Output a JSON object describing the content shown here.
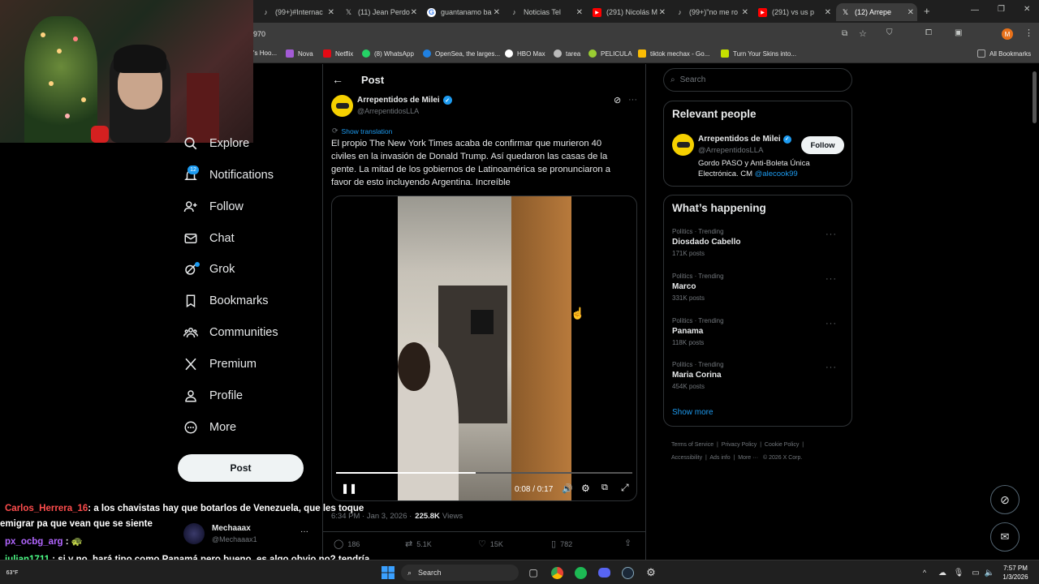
{
  "browser": {
    "tabs": [
      {
        "label": "(99+)#Internac",
        "icon": "tiktok-icon"
      },
      {
        "label": "(11) Jean Perdo",
        "icon": "x-icon"
      },
      {
        "label": "guantanamo ba",
        "icon": "google-icon"
      },
      {
        "label": "Noticias Tel",
        "icon": "tiktok-icon"
      },
      {
        "label": "(291) Nicolás M",
        "icon": "youtube-icon"
      },
      {
        "label": "(99+)\"no me ro",
        "icon": "tiktok-icon"
      },
      {
        "label": "(291) vs us p",
        "icon": "youtube-icon"
      },
      {
        "label": "(12) Arrepe",
        "icon": "x-icon"
      }
    ],
    "new_tab": "+",
    "address": "970",
    "bookmarks": [
      "'s Hoo...",
      "Nova",
      "Netflix",
      "(8) WhatsApp",
      "OpenSea, the larges...",
      "HBO Max",
      "tarea",
      "PELICULA",
      "tiktok mechax - Go...",
      "Turn Your Skins into..."
    ],
    "all_bookmarks": "All Bookmarks",
    "profile_letter": "M"
  },
  "sidebar": {
    "items": [
      {
        "label": "Explore",
        "icon": "search-icon"
      },
      {
        "label": "Notifications",
        "icon": "bell-icon",
        "badge": "12"
      },
      {
        "label": "Follow",
        "icon": "add-user-icon"
      },
      {
        "label": "Chat",
        "icon": "mail-icon"
      },
      {
        "label": "Grok",
        "icon": "grok-icon"
      },
      {
        "label": "Bookmarks",
        "icon": "bookmark-icon"
      },
      {
        "label": "Communities",
        "icon": "communities-icon"
      },
      {
        "label": "Premium",
        "icon": "x-logo-icon"
      },
      {
        "label": "Profile",
        "icon": "profile-icon"
      },
      {
        "label": "More",
        "icon": "more-icon"
      }
    ],
    "post_button": "Post",
    "account": {
      "name": "Mechaaax",
      "handle": "@Mechaaax1"
    }
  },
  "post": {
    "header": "Post",
    "author_name": "Arrepentidos de Milei",
    "author_handle": "@ArrepentidosLLA",
    "show_translation": "Show translation",
    "text": "El propio The New York Times acaba de confirmar que murieron 40 civiles en la invasión de Donald Trump. Así quedaron las casas de la gente. La mitad de los gobiernos de Latinoamérica se pronunciaron a favor de esto incluyendo Argentina. Increíble",
    "video": {
      "time": "0:08 / 0:17",
      "progress": 0.47
    },
    "meta_time": "6:34 PM · Jan 3, 2026 ·",
    "views_count": "225.8K",
    "views_label": "Views",
    "stats": {
      "replies": "186",
      "reposts": "5.1K",
      "likes": "15K",
      "bookmarks": "782"
    }
  },
  "right": {
    "search_placeholder": "Search",
    "relevant": {
      "title": "Relevant people",
      "name": "Arrepentidos de Milei",
      "handle": "@ArrepentidosLLA",
      "follow": "Follow",
      "bio": "Gordo PASO y Anti-Boleta Única Electrónica. CM",
      "bio_link": "@alecook99"
    },
    "happening": {
      "title": "What’s happening",
      "trends": [
        {
          "category": "Politics · Trending",
          "name": "Diosdado Cabello",
          "count": "171K posts"
        },
        {
          "category": "Politics · Trending",
          "name": "Marco",
          "count": "331K posts"
        },
        {
          "category": "Politics · Trending",
          "name": "Panama",
          "count": "118K posts"
        },
        {
          "category": "Politics · Trending",
          "name": "Maria Corina",
          "count": "454K posts"
        }
      ],
      "show_more": "Show more"
    },
    "footer": [
      "Terms of Service",
      "Privacy Policy",
      "Cookie Policy",
      "Accessibility",
      "Ads info",
      "More ···",
      "© 2026 X Corp."
    ]
  },
  "chat": [
    {
      "user": "Carlos_Herrera_16",
      "color": "#ff4d4d",
      "text": ": a los chavistas hay que botarlos de Venezuela, que les toque emigrar pa que vean que se siente"
    },
    {
      "user": "px_ocbg_arg",
      "color": "#b266ff",
      "text": ": 🐢"
    },
    {
      "user": "julian1711",
      "color": "#4dff88",
      "text": ": si y no, hará tipo como Panamá pero bueno, es algo obvio no? tendría que sacar algo positivo"
    }
  ],
  "taskbar": {
    "search": "Search",
    "weather": "63°F",
    "time": "7:57 PM",
    "date": "1/3/2026"
  }
}
